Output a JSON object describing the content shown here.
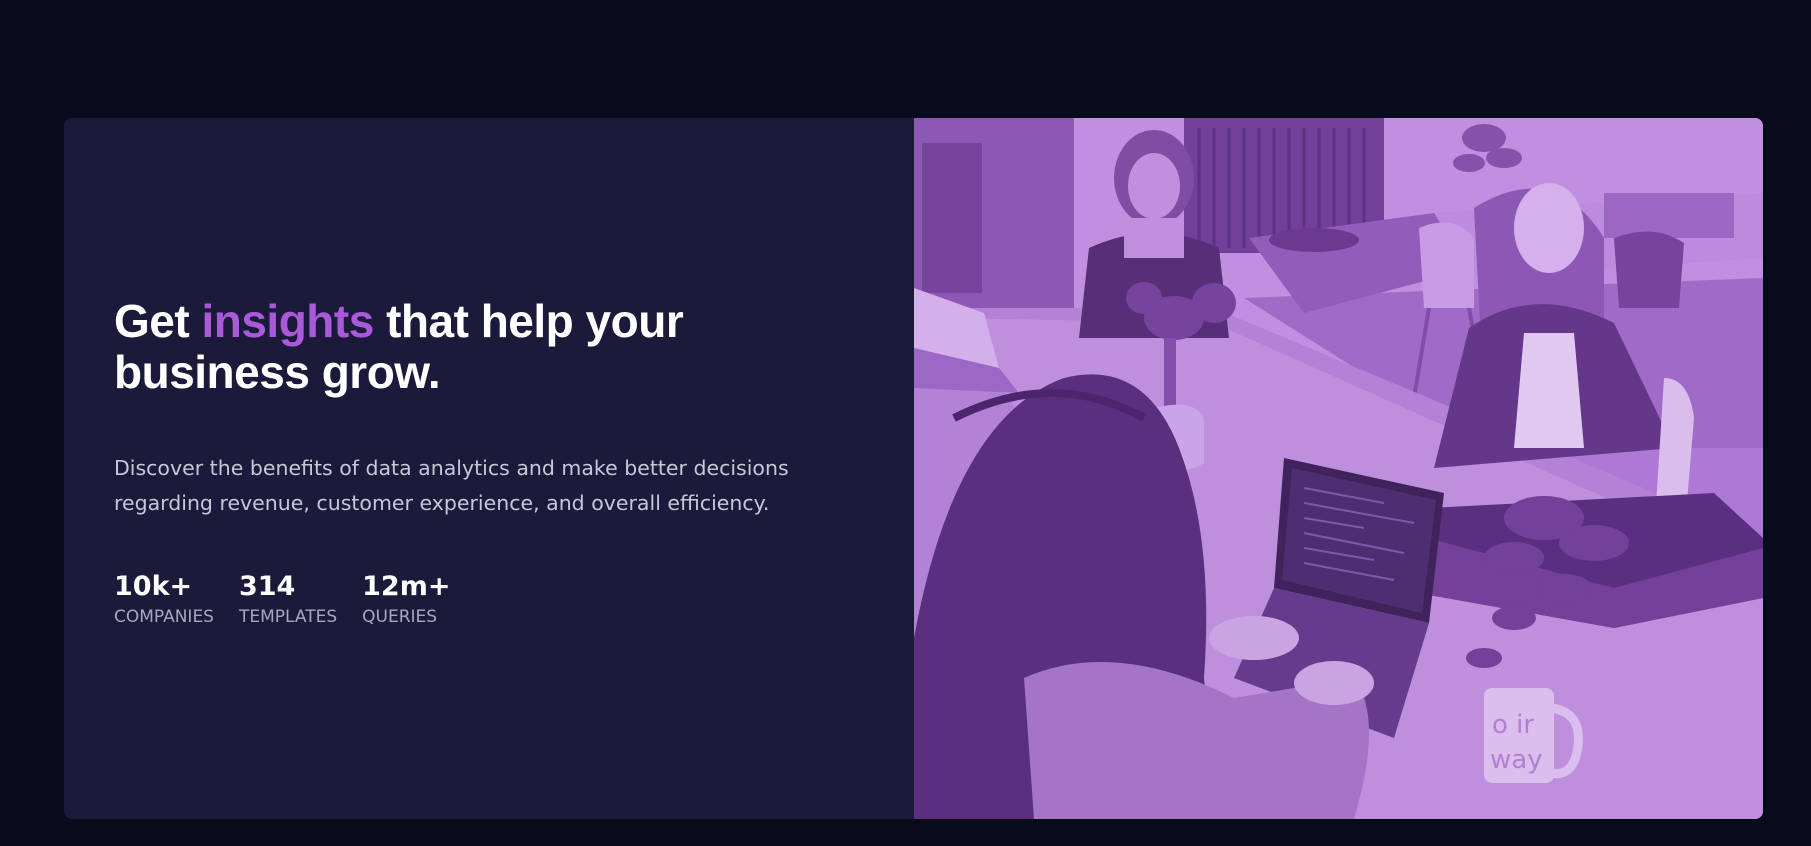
{
  "hero": {
    "headline_part1": "Get ",
    "headline_accent": "insights",
    "headline_part2": " that help your business grow.",
    "description": "Discover the benefits of data analytics and make better decisions regarding revenue, customer experience, and overall efficiency.",
    "stats": [
      {
        "value": "10k+",
        "label": "COMPANIES"
      },
      {
        "value": "314",
        "label": "TEMPLATES"
      },
      {
        "value": "12m+",
        "label": "QUERIES"
      }
    ]
  },
  "image": {
    "name": "office-team-photo",
    "mug_text_line1": "o ir",
    "mug_text_line2": "way"
  },
  "colors": {
    "page_background": "#090b1d",
    "card_background": "#1b1a3a",
    "accent": "#a95ad9",
    "photo_tint": "#a86bd1"
  }
}
